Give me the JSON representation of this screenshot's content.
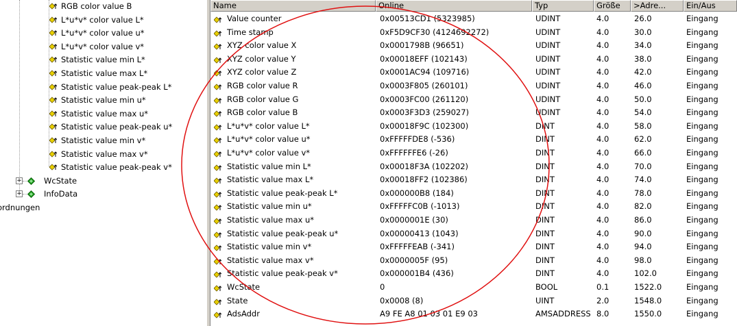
{
  "tree": {
    "items": [
      {
        "label": "RGB color value B",
        "kind": "var"
      },
      {
        "label": "L*u*v* color value L*",
        "kind": "var"
      },
      {
        "label": "L*u*v* color value u*",
        "kind": "var"
      },
      {
        "label": "L*u*v* color value v*",
        "kind": "var"
      },
      {
        "label": "Statistic value min L*",
        "kind": "var"
      },
      {
        "label": "Statistic value max L*",
        "kind": "var"
      },
      {
        "label": "Statistic value peak-peak L*",
        "kind": "var"
      },
      {
        "label": "Statistic value min u*",
        "kind": "var"
      },
      {
        "label": "Statistic value max u*",
        "kind": "var"
      },
      {
        "label": "Statistic value peak-peak u*",
        "kind": "var"
      },
      {
        "label": "Statistic value min v*",
        "kind": "var"
      },
      {
        "label": "Statistic value max v*",
        "kind": "var"
      },
      {
        "label": "Statistic value peak-peak v*",
        "kind": "var"
      },
      {
        "label": "WcState",
        "kind": "group"
      },
      {
        "label": "InfoData",
        "kind": "group"
      },
      {
        "label": "ordnungen",
        "kind": "partial"
      }
    ]
  },
  "table": {
    "headers": [
      "Name",
      "Online",
      "Typ",
      "Größe",
      ">Adre...",
      "Ein/Aus"
    ],
    "rows": [
      [
        "Value counter",
        "0x00513CD1 (5323985)",
        "UDINT",
        "4.0",
        "26.0",
        "Eingang"
      ],
      [
        "Time stamp",
        "0xF5D9CF30 (4124692272)",
        "UDINT",
        "4.0",
        "30.0",
        "Eingang"
      ],
      [
        "XYZ color value X",
        "0x0001798B (96651)",
        "UDINT",
        "4.0",
        "34.0",
        "Eingang"
      ],
      [
        "XYZ color value Y",
        "0x00018EFF (102143)",
        "UDINT",
        "4.0",
        "38.0",
        "Eingang"
      ],
      [
        "XYZ color value Z",
        "0x0001AC94 (109716)",
        "UDINT",
        "4.0",
        "42.0",
        "Eingang"
      ],
      [
        "RGB color value R",
        "0x0003F805 (260101)",
        "UDINT",
        "4.0",
        "46.0",
        "Eingang"
      ],
      [
        "RGB color value G",
        "0x0003FC00 (261120)",
        "UDINT",
        "4.0",
        "50.0",
        "Eingang"
      ],
      [
        "RGB color value B",
        "0x0003F3D3 (259027)",
        "UDINT",
        "4.0",
        "54.0",
        "Eingang"
      ],
      [
        "L*u*v* color value L*",
        "0x00018F9C (102300)",
        "DINT",
        "4.0",
        "58.0",
        "Eingang"
      ],
      [
        "L*u*v* color value u*",
        "0xFFFFFDE8 (-536)",
        "DINT",
        "4.0",
        "62.0",
        "Eingang"
      ],
      [
        "L*u*v* color value v*",
        "0xFFFFFFE6 (-26)",
        "DINT",
        "4.0",
        "66.0",
        "Eingang"
      ],
      [
        "Statistic value min L*",
        "0x00018F3A (102202)",
        "DINT",
        "4.0",
        "70.0",
        "Eingang"
      ],
      [
        "Statistic value max L*",
        "0x00018FF2 (102386)",
        "DINT",
        "4.0",
        "74.0",
        "Eingang"
      ],
      [
        "Statistic value peak-peak L*",
        "0x000000B8 (184)",
        "DINT",
        "4.0",
        "78.0",
        "Eingang"
      ],
      [
        "Statistic value min u*",
        "0xFFFFFC0B (-1013)",
        "DINT",
        "4.0",
        "82.0",
        "Eingang"
      ],
      [
        "Statistic value max u*",
        "0x0000001E (30)",
        "DINT",
        "4.0",
        "86.0",
        "Eingang"
      ],
      [
        "Statistic value peak-peak u*",
        "0x00000413 (1043)",
        "DINT",
        "4.0",
        "90.0",
        "Eingang"
      ],
      [
        "Statistic value min v*",
        "0xFFFFFEAB (-341)",
        "DINT",
        "4.0",
        "94.0",
        "Eingang"
      ],
      [
        "Statistic value max v*",
        "0x0000005F (95)",
        "DINT",
        "4.0",
        "98.0",
        "Eingang"
      ],
      [
        "Statistic value peak-peak v*",
        "0x000001B4 (436)",
        "DINT",
        "4.0",
        "102.0",
        "Eingang"
      ],
      [
        "WcState",
        "0",
        "BOOL",
        "0.1",
        "1522.0",
        "Eingang"
      ],
      [
        "State",
        "0x0008 (8)",
        "UINT",
        "2.0",
        "1548.0",
        "Eingang"
      ],
      [
        "AdsAddr",
        "A9 FE A8 01 03 01 E9 03",
        "AMSADDRESS",
        "8.0",
        "1550.0",
        "Eingang"
      ]
    ]
  },
  "icons": {
    "variable": "input-variable-icon",
    "group": "green-diamond-icon",
    "expand": "plus-expand-icon"
  },
  "colors": {
    "annotation": "#e01010",
    "chrome": "#d4d0c8",
    "var_icon": "#e8d000",
    "group_icon": "#1a9a1a"
  }
}
